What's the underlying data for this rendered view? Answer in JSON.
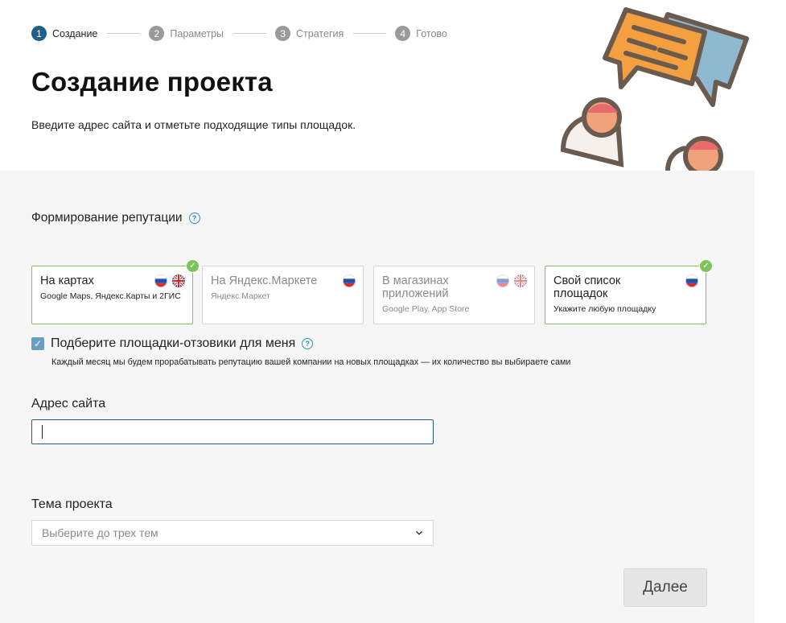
{
  "stepper": {
    "steps": [
      {
        "num": "1",
        "label": "Создание",
        "active": true
      },
      {
        "num": "2",
        "label": "Параметры",
        "active": false
      },
      {
        "num": "3",
        "label": "Стратегия",
        "active": false
      },
      {
        "num": "4",
        "label": "Готово",
        "active": false
      }
    ]
  },
  "header": {
    "title": "Создание проекта",
    "subtitle": "Введите адрес сайта и отметьте подходящие типы площадок."
  },
  "reputation": {
    "title": "Формирование репутации",
    "help": "?"
  },
  "cards": [
    {
      "title": "На картах",
      "subtitle": "Google Maps, Яндекс.Карты и 2ГИС",
      "selected": true,
      "flags": [
        "ru-flag-icon",
        "uk-flag-icon"
      ]
    },
    {
      "title": "На Яндекс.Маркете",
      "subtitle": "Яндекс.Маркет",
      "selected": false,
      "flags": [
        "ru-flag-icon"
      ]
    },
    {
      "title": "В магазинах приложений",
      "subtitle": "Google Play, App Store",
      "selected": false,
      "flags": [
        "ru-flag-icon",
        "uk-flag-icon"
      ]
    },
    {
      "title": "Свой список площадок",
      "subtitle": "Укажите любую площадку",
      "selected": true,
      "flags": [
        "ru-flag-icon"
      ]
    }
  ],
  "autopick": {
    "checked": true,
    "label": "Подберите площадки-отзовики для меня",
    "description": "Каждый месяц мы будем прорабатывать репутацию вашей компании на новых площадках — их количество вы выбираете сами"
  },
  "address": {
    "label": "Адрес сайта",
    "value": ""
  },
  "theme": {
    "label": "Тема проекта",
    "placeholder": "Выберите до трех тем"
  },
  "actions": {
    "next_label": "Далее"
  },
  "colors": {
    "accent": "#1f5f8b",
    "selected_border": "#7dc35b",
    "panel_bg": "#f6f6f6"
  }
}
